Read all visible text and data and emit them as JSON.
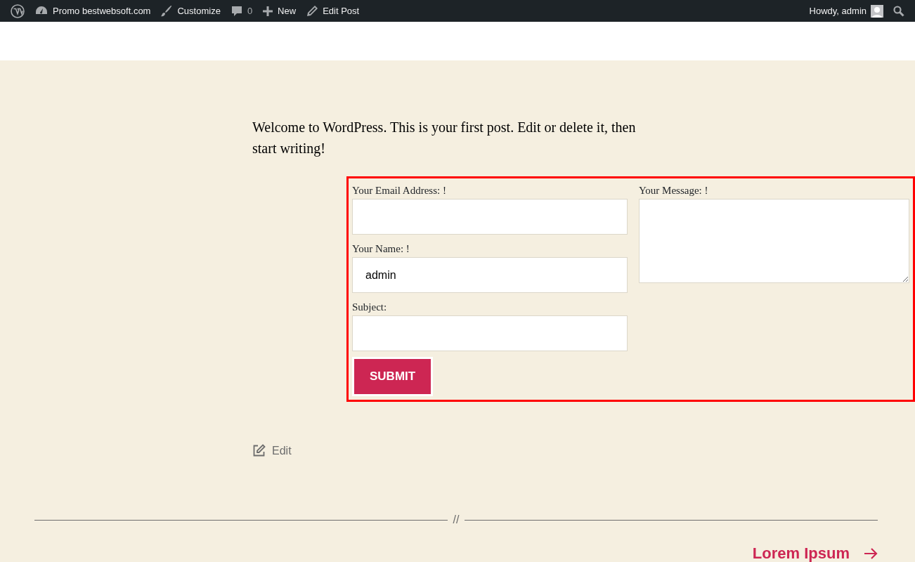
{
  "admin_bar": {
    "left_items": [
      {
        "kind": "wp"
      },
      {
        "kind": "site",
        "label": "Promo bestwebsoft.com"
      },
      {
        "kind": "customize",
        "label": "Customize"
      },
      {
        "kind": "comments",
        "label": "0"
      },
      {
        "kind": "new",
        "label": "New"
      },
      {
        "kind": "edit",
        "label": "Edit Post"
      }
    ],
    "greeting": "Howdy, admin"
  },
  "post": {
    "text": "Welcome to WordPress. This is your first post. Edit or delete it, then start writing!"
  },
  "form": {
    "left_fields": [
      {
        "label": "Your Email Address: !"
      },
      {
        "label": "Your Name: !",
        "value": "admin"
      },
      {
        "label": "Subject:"
      }
    ],
    "message": {
      "label": "Your Message: !"
    },
    "submit": "SUBMIT"
  },
  "edit_link": "Edit",
  "separator": "//",
  "next_post": "Lorem Ipsum"
}
